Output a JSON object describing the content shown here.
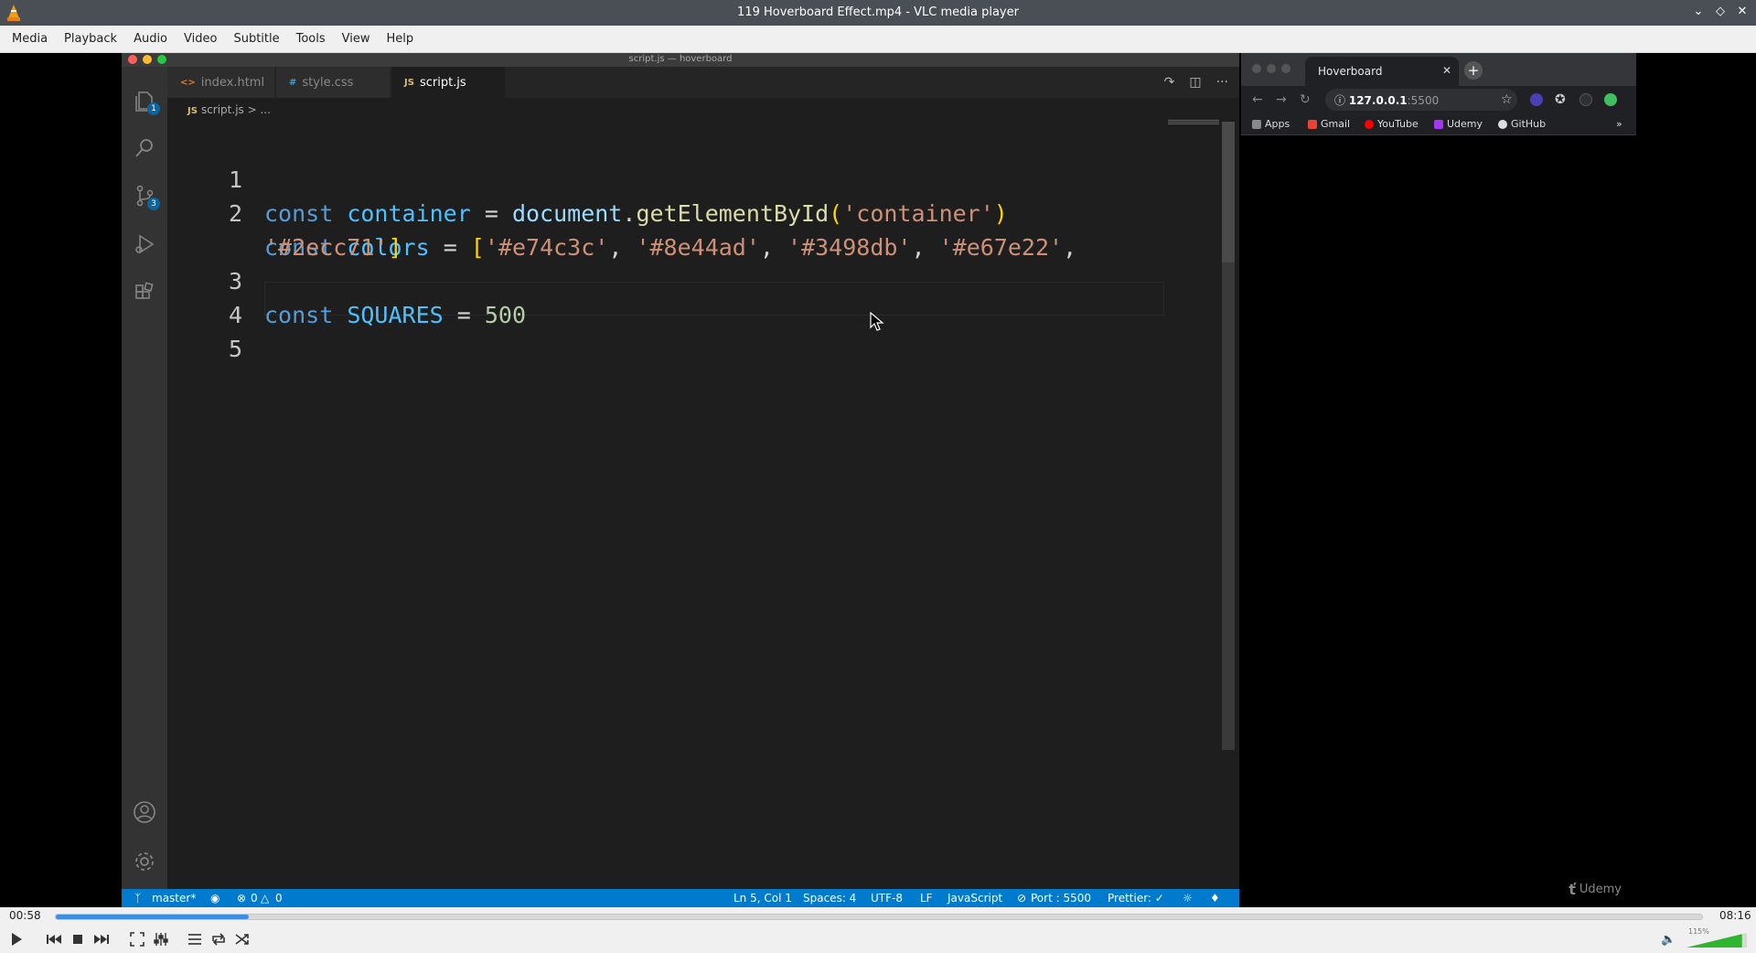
{
  "window": {
    "title": "119 Hoverboard Effect.mp4 - VLC media player"
  },
  "menu": [
    "Media",
    "Playback",
    "Audio",
    "Video",
    "Subtitle",
    "Tools",
    "View",
    "Help"
  ],
  "vscode": {
    "title": "script.js — hoverboard",
    "tabs": [
      {
        "icon": "<>",
        "label": "index.html"
      },
      {
        "icon": "#",
        "label": "style.css"
      },
      {
        "icon": "JS",
        "label": "script.js"
      }
    ],
    "breadcrumb": {
      "file": "script.js",
      "sep": "> ..."
    },
    "badges": {
      "explorer": "1",
      "scm": "3"
    },
    "lines": [
      "1",
      "2",
      "3",
      "4",
      "5"
    ],
    "code": {
      "l1": {
        "kw": "const",
        "name": "container",
        "eq": " = ",
        "obj": "document",
        "dot": ".",
        "fn": "getElementById",
        "open": "(",
        "arg": "'container'",
        "close": ")"
      },
      "l2": {
        "kw": "const",
        "name": "colors",
        "eq": " = ",
        "open": "[",
        "s1": "'#e74c3c'",
        "c1": ", ",
        "s2": "'#8e44ad'",
        "c2": ", ",
        "s3": "'#3498db'",
        "c3": ", ",
        "s4": "'#e67e22'",
        "c4": ",",
        "s5": "'#2ecc71'",
        "close": "]"
      },
      "l3": {
        "kw": "const",
        "name": "SQUARES",
        "eq": " = ",
        "num": "500"
      }
    },
    "status": {
      "branch": "master*",
      "errors": "0",
      "warnings": "0",
      "position": "Ln 5, Col 1",
      "spaces": "Spaces: 4",
      "encoding": "UTF-8",
      "eol": "LF",
      "language": "JavaScript",
      "port": "Port : 5500",
      "prettier": "Prettier: ✓"
    }
  },
  "browser": {
    "tab_title": "Hoverboard",
    "url_host": "127.0.0.1",
    "url_port": ":5500",
    "bookmarks": [
      "Apps",
      "Gmail",
      "YouTube",
      "Udemy",
      "GitHub"
    ],
    "watermark": "Udemy"
  },
  "player": {
    "elapsed": "00:58",
    "total": "08:16",
    "progress": 0.117,
    "volume_label": "115%",
    "volume": 1.15
  },
  "colors": {
    "accent": "#007acc",
    "seek": "#3d8ee0",
    "volume": "#2fb52f"
  }
}
